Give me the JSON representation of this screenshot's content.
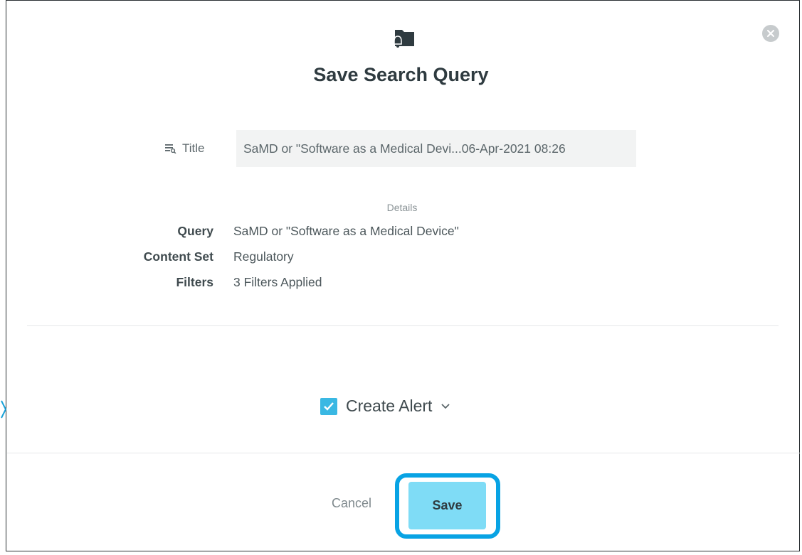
{
  "dialog": {
    "heading": "Save Search Query",
    "header_icon": "folder-bell-icon",
    "close_icon": "close-icon"
  },
  "title_field": {
    "label": "Title",
    "icon": "list-search-icon",
    "value": "SaMD or \"Software as a Medical Devi...06-Apr-2021 08:26"
  },
  "details": {
    "heading": "Details",
    "rows": [
      {
        "key": "Query",
        "value": "SaMD or \"Software as a Medical Device\""
      },
      {
        "key": "Content Set",
        "value": "Regulatory"
      },
      {
        "key": "Filters",
        "value": "3 Filters Applied"
      }
    ]
  },
  "alert": {
    "label": "Create Alert",
    "checked": true,
    "checkbox_color": "#3ab8e3",
    "chevron_icon": "chevron-down-icon"
  },
  "footer": {
    "cancel_label": "Cancel",
    "save_label": "Save",
    "save_color": "#7fdcf6",
    "highlight_color": "#08a3e4"
  }
}
